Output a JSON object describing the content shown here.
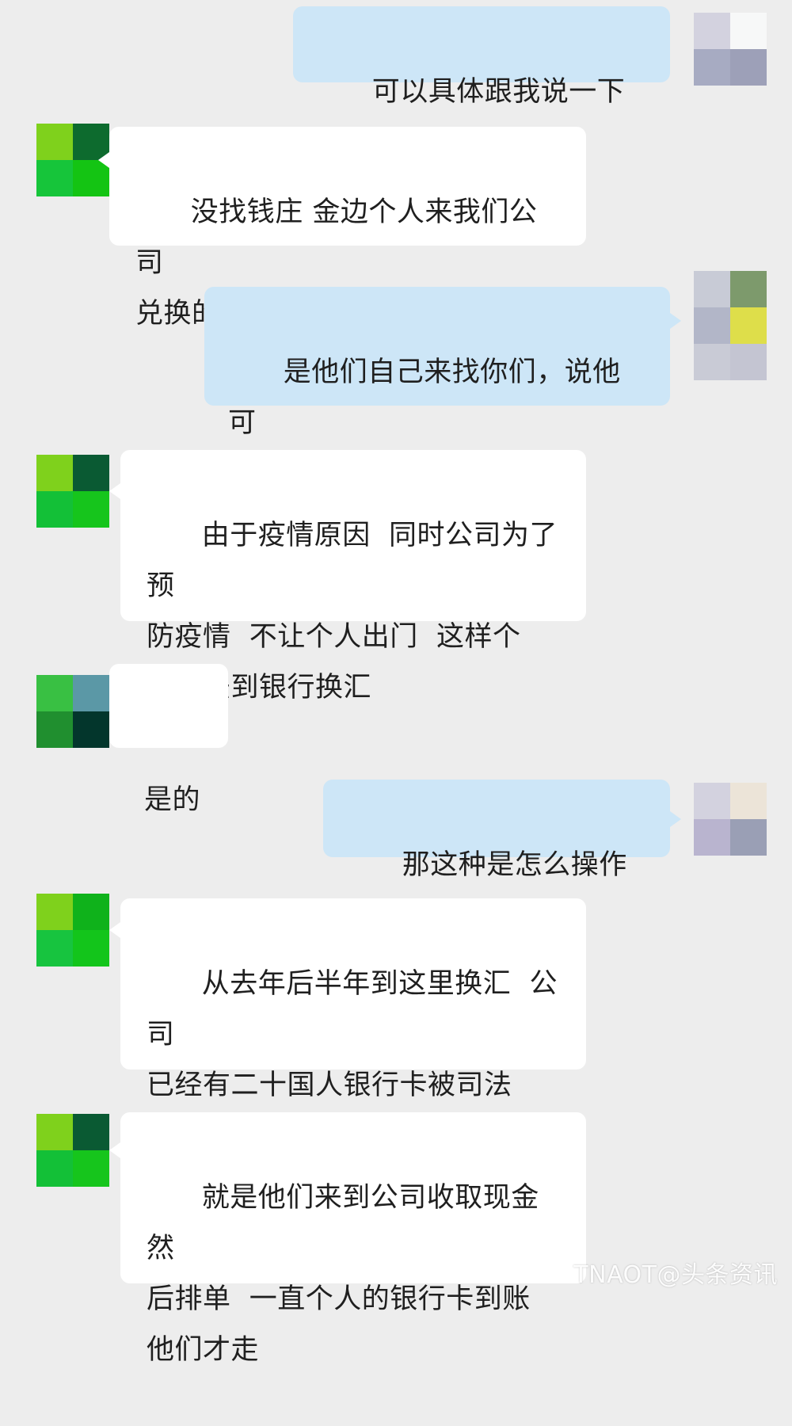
{
  "messages": [
    {
      "side": "right",
      "text": "可以具体跟我说一下吗?"
    },
    {
      "side": "left",
      "text": "没找钱庄 金边个人来我们公司\n兑换的"
    },
    {
      "side": "right",
      "text": "是他们自己来找你们，说他可\n以换汇的吗?"
    },
    {
      "side": "left",
      "text": "由于疫情原因  同时公司为了预\n防疫情  不让个人出门  这样个\n人无法到银行换汇"
    },
    {
      "side": "left",
      "text": "是的"
    },
    {
      "side": "right",
      "text": "那这种是怎么操作的呢"
    },
    {
      "side": "left",
      "text": "从去年后半年到这里换汇  公司\n已经有二十国人银行卡被司法\n机关冻结了"
    },
    {
      "side": "left",
      "text": "就是他们来到公司收取现金  然\n后排单  一直个人的银行卡到账\n他们才走"
    }
  ],
  "watermark": "TNAOT@头条资讯",
  "colors": {
    "background": "#ededed",
    "bubble_left": "#ffffff",
    "bubble_right": "#cde6f7",
    "text": "#1f1f1f"
  }
}
